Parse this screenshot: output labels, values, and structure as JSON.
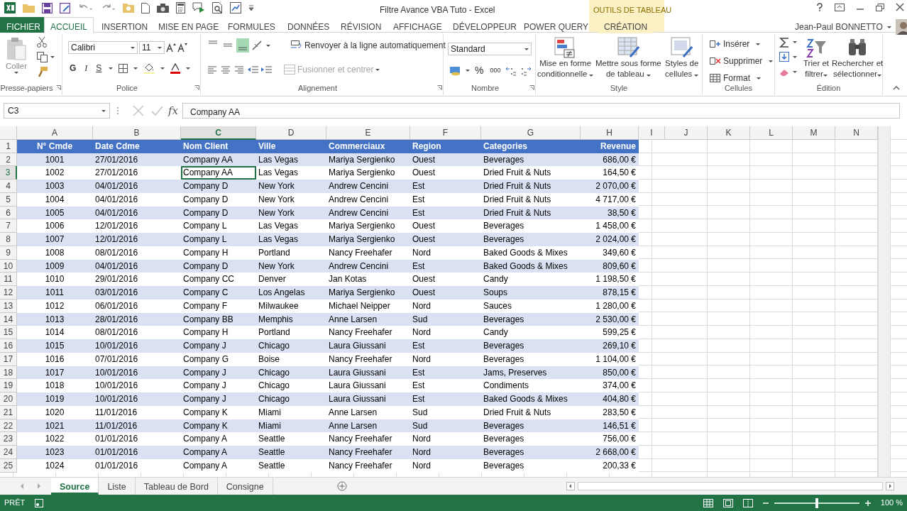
{
  "window": {
    "title": "Filtre Avance VBA Tuto - Excel",
    "contextual_group": "OUTILS DE TABLEAU",
    "user": "Jean-Paul BONNETTO"
  },
  "ribbon_tabs": [
    {
      "label": "FICHIER",
      "kind": "file",
      "selected": false
    },
    {
      "label": "ACCUEIL",
      "kind": "tab",
      "selected": true
    },
    {
      "label": "INSERTION",
      "kind": "tab",
      "selected": false
    },
    {
      "label": "MISE EN PAGE",
      "kind": "tab",
      "selected": false
    },
    {
      "label": "FORMULES",
      "kind": "tab",
      "selected": false
    },
    {
      "label": "DONNÉES",
      "kind": "tab",
      "selected": false
    },
    {
      "label": "RÉVISION",
      "kind": "tab",
      "selected": false
    },
    {
      "label": "AFFICHAGE",
      "kind": "tab",
      "selected": false
    },
    {
      "label": "DÉVELOPPEUR",
      "kind": "tab",
      "selected": false
    },
    {
      "label": "POWER QUERY",
      "kind": "tab",
      "selected": false
    },
    {
      "label": "CRÉATION",
      "kind": "contextual",
      "selected": false
    }
  ],
  "ribbon": {
    "clipboard": {
      "label": "Presse-papiers",
      "paste": "Coller"
    },
    "font": {
      "label": "Police",
      "font_name": "Calibri",
      "font_size": "11",
      "bold": "G",
      "italic": "I",
      "underline": "S"
    },
    "alignment": {
      "label": "Alignement",
      "vertical_buttons": [
        {
          "selected": false
        },
        {
          "selected": false
        },
        {
          "selected": true
        }
      ],
      "wrap": "Renvoyer à la ligne automatiquement",
      "merge": "Fusionner et centrer",
      "merge_disabled": true
    },
    "number": {
      "label": "Nombre",
      "format": "Standard",
      "percent": "%",
      "thousands": "000"
    },
    "style": {
      "label": "Style",
      "buttons": [
        "Mise en forme\nconditionnelle",
        "Mettre sous forme\nde tableau",
        "Styles de\ncellules"
      ]
    },
    "cells": {
      "label": "Cellules",
      "buttons": [
        "Insérer",
        "Supprimer",
        "Format"
      ]
    },
    "editing": {
      "label": "Édition",
      "sort": "Trier et\nfiltrer",
      "find": "Rechercher et\nsélectionner"
    }
  },
  "formula_bar": {
    "name_box": "C3",
    "function_symbol": "fx",
    "formula": "Company AA"
  },
  "sheet": {
    "columns": [
      {
        "label": "A",
        "selected": false
      },
      {
        "label": "B",
        "selected": false
      },
      {
        "label": "C",
        "selected": true
      },
      {
        "label": "D",
        "selected": false
      },
      {
        "label": "E",
        "selected": false
      },
      {
        "label": "F",
        "selected": false
      },
      {
        "label": "G",
        "selected": false
      },
      {
        "label": "H",
        "selected": false
      },
      {
        "label": "I",
        "selected": false
      },
      {
        "label": "J",
        "selected": false
      },
      {
        "label": "K",
        "selected": false
      },
      {
        "label": "L",
        "selected": false
      },
      {
        "label": "M",
        "selected": false
      },
      {
        "label": "N",
        "selected": false
      }
    ],
    "header_row": {
      "number": "1",
      "cells": [
        "N° Cmde",
        "Date Cdme",
        "Nom Client",
        "Ville",
        "Commerciaux",
        "Region",
        "Categories",
        "Revenue"
      ]
    },
    "rows": [
      {
        "number": "2",
        "selected": false,
        "cells": [
          "1001",
          "27/01/2016",
          "Company AA",
          "Las Vegas",
          "Mariya Sergienko",
          "Ouest",
          "Beverages",
          "686,00 €"
        ]
      },
      {
        "number": "3",
        "selected": true,
        "cells": [
          "1002",
          "27/01/2016",
          "Company AA",
          "Las Vegas",
          "Mariya Sergienko",
          "Ouest",
          "Dried Fruit & Nuts",
          "164,50 €"
        ]
      },
      {
        "number": "4",
        "selected": false,
        "cells": [
          "1003",
          "04/01/2016",
          "Company D",
          "New York",
          "Andrew Cencini",
          "Est",
          "Dried Fruit & Nuts",
          "2 070,00 €"
        ]
      },
      {
        "number": "5",
        "selected": false,
        "cells": [
          "1004",
          "04/01/2016",
          "Company D",
          "New York",
          "Andrew Cencini",
          "Est",
          "Dried Fruit & Nuts",
          "4 717,00 €"
        ]
      },
      {
        "number": "6",
        "selected": false,
        "cells": [
          "1005",
          "04/01/2016",
          "Company D",
          "New York",
          "Andrew Cencini",
          "Est",
          "Dried Fruit & Nuts",
          "38,50 €"
        ]
      },
      {
        "number": "7",
        "selected": false,
        "cells": [
          "1006",
          "12/01/2016",
          "Company L",
          "Las Vegas",
          "Mariya Sergienko",
          "Ouest",
          "Beverages",
          "1 458,00 €"
        ]
      },
      {
        "number": "8",
        "selected": false,
        "cells": [
          "1007",
          "12/01/2016",
          "Company L",
          "Las Vegas",
          "Mariya Sergienko",
          "Ouest",
          "Beverages",
          "2 024,00 €"
        ]
      },
      {
        "number": "9",
        "selected": false,
        "cells": [
          "1008",
          "08/01/2016",
          "Company H",
          "Portland",
          "Nancy Freehafer",
          "Nord",
          "Baked Goods & Mixes",
          "349,60 €"
        ]
      },
      {
        "number": "10",
        "selected": false,
        "cells": [
          "1009",
          "04/01/2016",
          "Company D",
          "New York",
          "Andrew Cencini",
          "Est",
          "Baked Goods & Mixes",
          "809,60 €"
        ]
      },
      {
        "number": "11",
        "selected": false,
        "cells": [
          "1010",
          "29/01/2016",
          "Company CC",
          "Denver",
          "Jan Kotas",
          "Ouest",
          "Candy",
          "1 198,50 €"
        ]
      },
      {
        "number": "12",
        "selected": false,
        "cells": [
          "1011",
          "03/01/2016",
          "Company C",
          "Los Angelas",
          "Mariya Sergienko",
          "Ouest",
          "Soups",
          "878,15 €"
        ]
      },
      {
        "number": "13",
        "selected": false,
        "cells": [
          "1012",
          "06/01/2016",
          "Company F",
          "Milwaukee",
          "Michael Neipper",
          "Nord",
          "Sauces",
          "1 280,00 €"
        ]
      },
      {
        "number": "14",
        "selected": false,
        "cells": [
          "1013",
          "28/01/2016",
          "Company BB",
          "Memphis",
          "Anne Larsen",
          "Sud",
          "Beverages",
          "2 530,00 €"
        ]
      },
      {
        "number": "15",
        "selected": false,
        "cells": [
          "1014",
          "08/01/2016",
          "Company H",
          "Portland",
          "Nancy Freehafer",
          "Nord",
          "Candy",
          "599,25 €"
        ]
      },
      {
        "number": "16",
        "selected": false,
        "cells": [
          "1015",
          "10/01/2016",
          "Company J",
          "Chicago",
          "Laura Giussani",
          "Est",
          "Beverages",
          "269,10 €"
        ]
      },
      {
        "number": "17",
        "selected": false,
        "cells": [
          "1016",
          "07/01/2016",
          "Company G",
          "Boise",
          "Nancy Freehafer",
          "Nord",
          "Beverages",
          "1 104,00 €"
        ]
      },
      {
        "number": "18",
        "selected": false,
        "cells": [
          "1017",
          "10/01/2016",
          "Company J",
          "Chicago",
          "Laura Giussani",
          "Est",
          "Jams, Preserves",
          "850,00 €"
        ]
      },
      {
        "number": "19",
        "selected": false,
        "cells": [
          "1018",
          "10/01/2016",
          "Company J",
          "Chicago",
          "Laura Giussani",
          "Est",
          "Condiments",
          "374,00 €"
        ]
      },
      {
        "number": "20",
        "selected": false,
        "cells": [
          "1019",
          "10/01/2016",
          "Company J",
          "Chicago",
          "Laura Giussani",
          "Est",
          "Baked Goods & Mixes",
          "404,80 €"
        ]
      },
      {
        "number": "21",
        "selected": false,
        "cells": [
          "1020",
          "11/01/2016",
          "Company K",
          "Miami",
          "Anne Larsen",
          "Sud",
          "Dried Fruit & Nuts",
          "283,50 €"
        ]
      },
      {
        "number": "22",
        "selected": false,
        "cells": [
          "1021",
          "11/01/2016",
          "Company K",
          "Miami",
          "Anne Larsen",
          "Sud",
          "Beverages",
          "146,51 €"
        ]
      },
      {
        "number": "23",
        "selected": false,
        "cells": [
          "1022",
          "01/01/2016",
          "Company A",
          "Seattle",
          "Nancy Freehafer",
          "Nord",
          "Beverages",
          "756,00 €"
        ]
      },
      {
        "number": "24",
        "selected": false,
        "cells": [
          "1023",
          "01/01/2016",
          "Company A",
          "Seattle",
          "Nancy Freehafer",
          "Nord",
          "Beverages",
          "2 668,00 €"
        ]
      },
      {
        "number": "25",
        "selected": false,
        "cells": [
          "1024",
          "01/01/2016",
          "Company A",
          "Seattle",
          "Nancy Freehafer",
          "Nord",
          "Beverages",
          "200,33 €"
        ]
      }
    ]
  },
  "sheet_tabs": [
    {
      "label": "Source",
      "selected": true
    },
    {
      "label": "Liste",
      "selected": false
    },
    {
      "label": "Tableau de Bord",
      "selected": false
    },
    {
      "label": "Consigne",
      "selected": false
    }
  ],
  "status_bar": {
    "status": "PRÊT",
    "zoom": "100 %",
    "zoom_slider": {
      "level": 0.5
    }
  }
}
